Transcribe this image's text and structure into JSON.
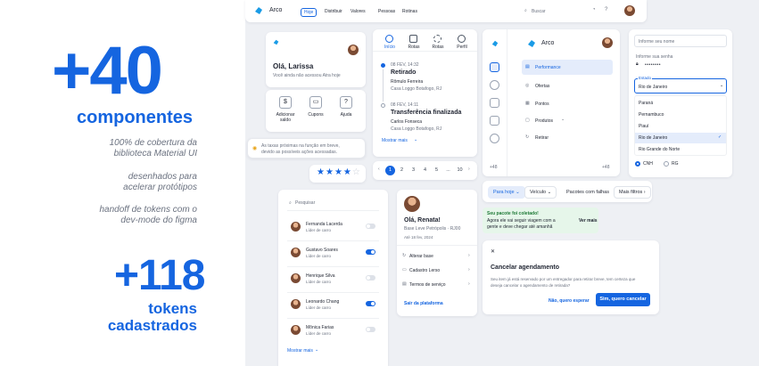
{
  "hero": {
    "components_count": "+40",
    "components_label": "componentes",
    "line1": "100% de cobertura da",
    "line2": "biblioteca Material UI",
    "line3": "desenhados para",
    "line4": "acelerar protótipos",
    "line5": "handoff de tokens com o",
    "line6": "dev-mode do figma",
    "tokens_count": "+118",
    "tokens_label1": "tokens",
    "tokens_label2": "cadastrados"
  },
  "topnav": {
    "logo": "Arco",
    "items": [
      "Hoje",
      "Distribuir",
      "Valores",
      "Pessoas",
      "Rotinas"
    ],
    "search_placeholder": "Buscar"
  },
  "welcome": {
    "greeting": "Olá, Larissa",
    "sub": "Você ainda não acessou Atra hoje",
    "actions": [
      "Adicionar saldo",
      "Cupons",
      "Ajuda"
    ]
  },
  "alert": {
    "text1": "As taxas próximas na função em breve,",
    "text2": "devido as possíveis ações acessadas."
  },
  "rating": {
    "stars": 4,
    "max": 5
  },
  "timeline": {
    "tabs": [
      "Início",
      "Rotas",
      "Rotas",
      "Perfil"
    ],
    "entries": [
      {
        "date": "08 FEV, 14:32",
        "title": "Retirado",
        "line1": "Rômulo Ferreira",
        "line2": "Casa Loggo Botafogo, RJ"
      },
      {
        "date": "08 FEV, 14:11",
        "title": "Transferência finalizada",
        "line1": "Carlos Fonseca",
        "line2": "Casa Loggo Botafogo, RJ"
      }
    ],
    "more": "Mostrar mais"
  },
  "pagination": {
    "pages": [
      "1",
      "2",
      "3",
      "4",
      "5",
      "...",
      "10"
    ],
    "active": "1"
  },
  "sidebar": {
    "logo": "Arco",
    "items": [
      "Performance",
      "Ofertas",
      "Pontos",
      "Produtos",
      "Retirar"
    ],
    "active": "Performance",
    "badge": "+48",
    "rail_badge": "+48"
  },
  "form": {
    "name_placeholder": "Informe seu nome",
    "password_label": "Informe sua senha",
    "password_value": "••••••••",
    "state_label": "Estado",
    "state_value": "Rio de Janeiro",
    "options": [
      "Paraná",
      "Pernambuco",
      "Piauí",
      "Rio de Janeiro",
      "Rio Grande do Norte"
    ],
    "selected": "Rio de Janeiro",
    "radio_cnh": "CNH",
    "radio_rg": "RG"
  },
  "filters": {
    "chips": [
      "Para hoje",
      "Veículo",
      "Pacotes com falhas",
      "Mais filtros"
    ]
  },
  "snackbar": {
    "title": "Seu pacote foi coletado!",
    "text1": "Agora ele vai seguir viagem com a",
    "text2": "gente e deve chegar até amanhã",
    "action": "Ver mais"
  },
  "dialog": {
    "close": "✕",
    "title": "Cancelar agendamento",
    "body1": "Seu item já está reservado por um entregador para retirar breve, tem certeza que",
    "body2": "deseja cancelar o agendamento de retirada?",
    "secondary": "Não, quero esperar",
    "primary": "Sim, quero cancelar"
  },
  "userlist": {
    "search_placeholder": "Pesquisar",
    "users": [
      {
        "name": "Fernanda Lacerda",
        "role": "Líder de carro",
        "on": false
      },
      {
        "name": "Gustavo Soares",
        "role": "Líder de carro",
        "on": true
      },
      {
        "name": "Henrique Silva",
        "role": "Líder de carro",
        "on": false
      },
      {
        "name": "Leonardo Chang",
        "role": "Líder de carro",
        "on": true
      },
      {
        "name": "Mônica Farias",
        "role": "Líder de carro",
        "on": false
      }
    ],
    "more": "Mostrar mais"
  },
  "profile": {
    "greeting": "Olá, Renata!",
    "sub": "Base Leve Petrópolis · RJ00",
    "since": "Até 18 fev, 2024",
    "menu": [
      "Alterar base",
      "Cadastro Lerso",
      "Termos de serviço"
    ],
    "logout": "Sair da plataforma"
  },
  "colors": {
    "accent": "#1565e0",
    "canvas": "#eef0f4"
  }
}
